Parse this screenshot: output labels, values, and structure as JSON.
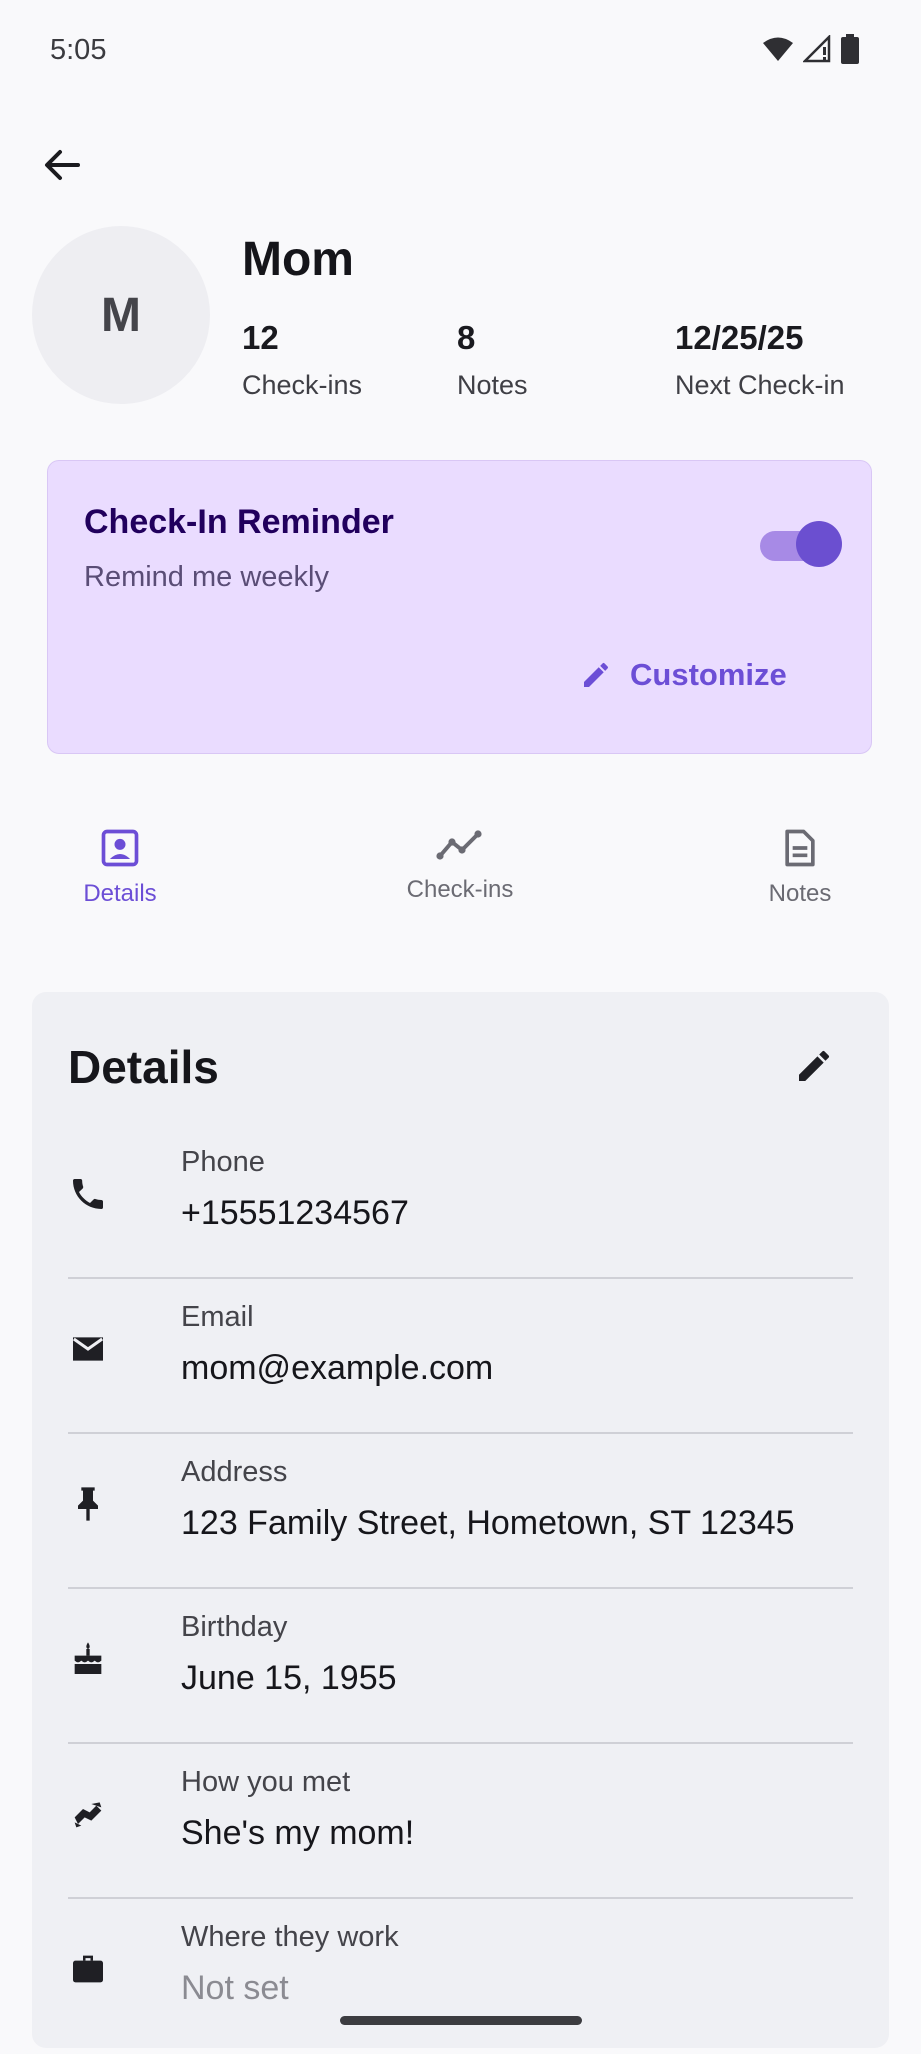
{
  "status": {
    "time": "5:05"
  },
  "contact": {
    "initial": "M",
    "name": "Mom",
    "stats": [
      {
        "value": "12",
        "label": "Check-ins"
      },
      {
        "value": "8",
        "label": "Notes"
      },
      {
        "value": "12/25/25",
        "label": "Next Check-in"
      }
    ]
  },
  "reminder": {
    "title": "Check-In Reminder",
    "subtitle": "Remind me weekly",
    "enabled": true,
    "customize_label": "Customize"
  },
  "tabs": [
    {
      "label": "Details",
      "icon": "contact-card-icon",
      "active": true
    },
    {
      "label": "Check-ins",
      "icon": "trend-line-icon",
      "active": false
    },
    {
      "label": "Notes",
      "icon": "document-icon",
      "active": false
    }
  ],
  "details": {
    "title": "Details",
    "fields": [
      {
        "label": "Phone",
        "value": "+15551234567",
        "icon": "phone-icon"
      },
      {
        "label": "Email",
        "value": "mom@example.com",
        "icon": "email-icon"
      },
      {
        "label": "Address",
        "value": "123 Family Street, Hometown, ST 12345",
        "icon": "pin-icon"
      },
      {
        "label": "Birthday",
        "value": "June 15, 1955",
        "icon": "cake-icon"
      },
      {
        "label": "How you met",
        "value": "She's my mom!",
        "icon": "handshake-icon"
      },
      {
        "label": "Where they work",
        "value": "Not set",
        "icon": "briefcase-icon"
      }
    ]
  },
  "colors": {
    "accent": "#6c4ed6",
    "reminder_bg": "#eadcff",
    "card_bg": "#eff0f4"
  }
}
